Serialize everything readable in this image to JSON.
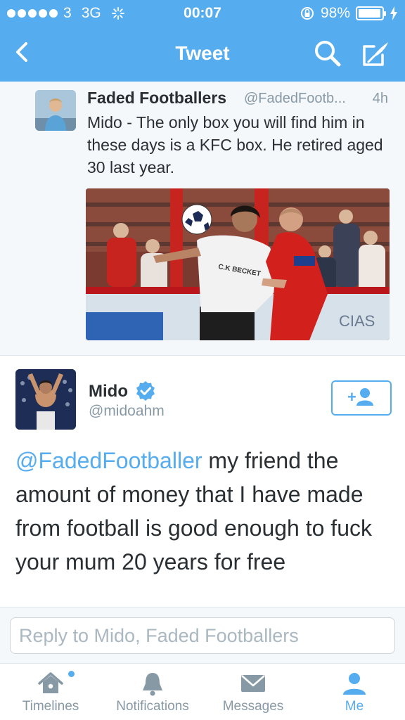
{
  "status_bar": {
    "carrier": "3",
    "network": "3G",
    "time": "00:07",
    "battery": "98%",
    "battery_level": 0.98
  },
  "nav": {
    "title": "Tweet",
    "back_icon": "chevron-left-icon",
    "search_icon": "search-icon",
    "compose_icon": "compose-icon"
  },
  "original_tweet": {
    "name": "Faded Footballers",
    "handle": "@FadedFootb...",
    "age": "4h",
    "text": "Mido - The only box you will find him in these days is a KFC box. He retired aged 30 last year.",
    "photo_banner_text": "CIAS"
  },
  "main_tweet": {
    "name": "Mido",
    "handle": "@midoahm",
    "mention": "@FadedFootballer",
    "text": " my friend the amount of money that I have made from football is good enough to fuck  your mum 20 years for free",
    "verified_icon": "verified-badge-icon",
    "follow_icon": "add-user-icon"
  },
  "reply": {
    "placeholder": "Reply to Mido, Faded Footballers"
  },
  "tabbar": {
    "tabs": [
      {
        "label": "Timelines",
        "icon": "home-icon"
      },
      {
        "label": "Notifications",
        "icon": "bell-icon"
      },
      {
        "label": "Messages",
        "icon": "envelope-icon"
      },
      {
        "label": "Me",
        "icon": "person-icon",
        "active": true
      }
    ]
  },
  "colors": {
    "accent": "#55acee",
    "text": "#292f33",
    "muted": "#8899a6",
    "background_alt": "#f5f8fa"
  }
}
